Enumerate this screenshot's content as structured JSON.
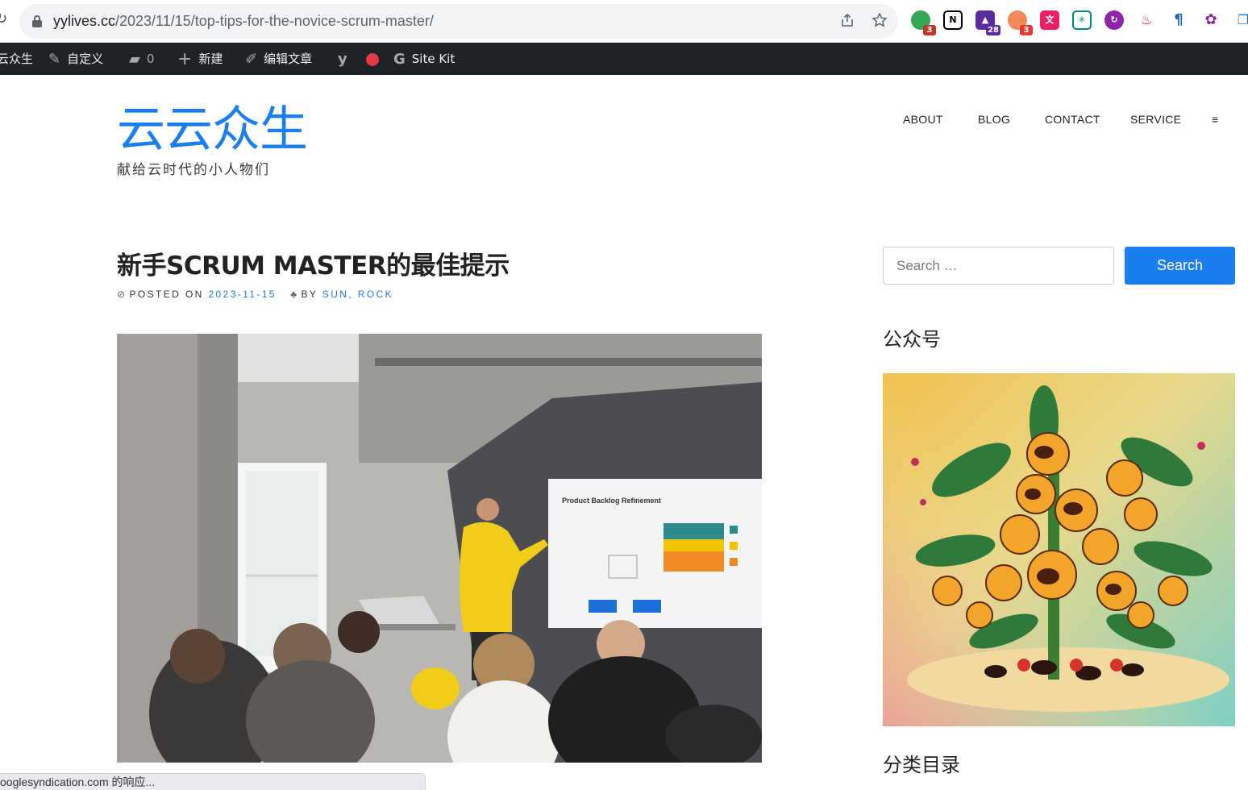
{
  "browser": {
    "url_host": "yylives.cc",
    "url_path": "/2023/11/15/top-tips-for-the-novice-scrum-master/",
    "extension_badges": [
      "3",
      "28",
      "3"
    ]
  },
  "admin_bar": {
    "site_name": "云众生",
    "customize": "自定义",
    "comments_count": "0",
    "new": "新建",
    "edit_post": "编辑文章",
    "site_kit": "Site Kit"
  },
  "site": {
    "title": "云云众生",
    "description": "献给云时代的小人物们",
    "title_color": "#1a7ef0"
  },
  "nav": {
    "items": [
      "ABOUT",
      "BLOG",
      "CONTACT",
      "SERVICE"
    ],
    "menu_icon": "≡"
  },
  "post": {
    "title": "新手SCRUM MASTER的最佳提示",
    "posted_on_label": "POSTED ON",
    "date": "2023-11-15",
    "by_label": "BY",
    "author": "SUN, ROCK"
  },
  "featured_image": {
    "board_title": "Product Backlog Refinement"
  },
  "sidebar": {
    "search_placeholder": "Search …",
    "search_button": "Search",
    "widget1_title": "公众号",
    "widget2_title": "分类目录"
  },
  "status_bar": {
    "text": "ooglesyndication.com 的响应..."
  }
}
